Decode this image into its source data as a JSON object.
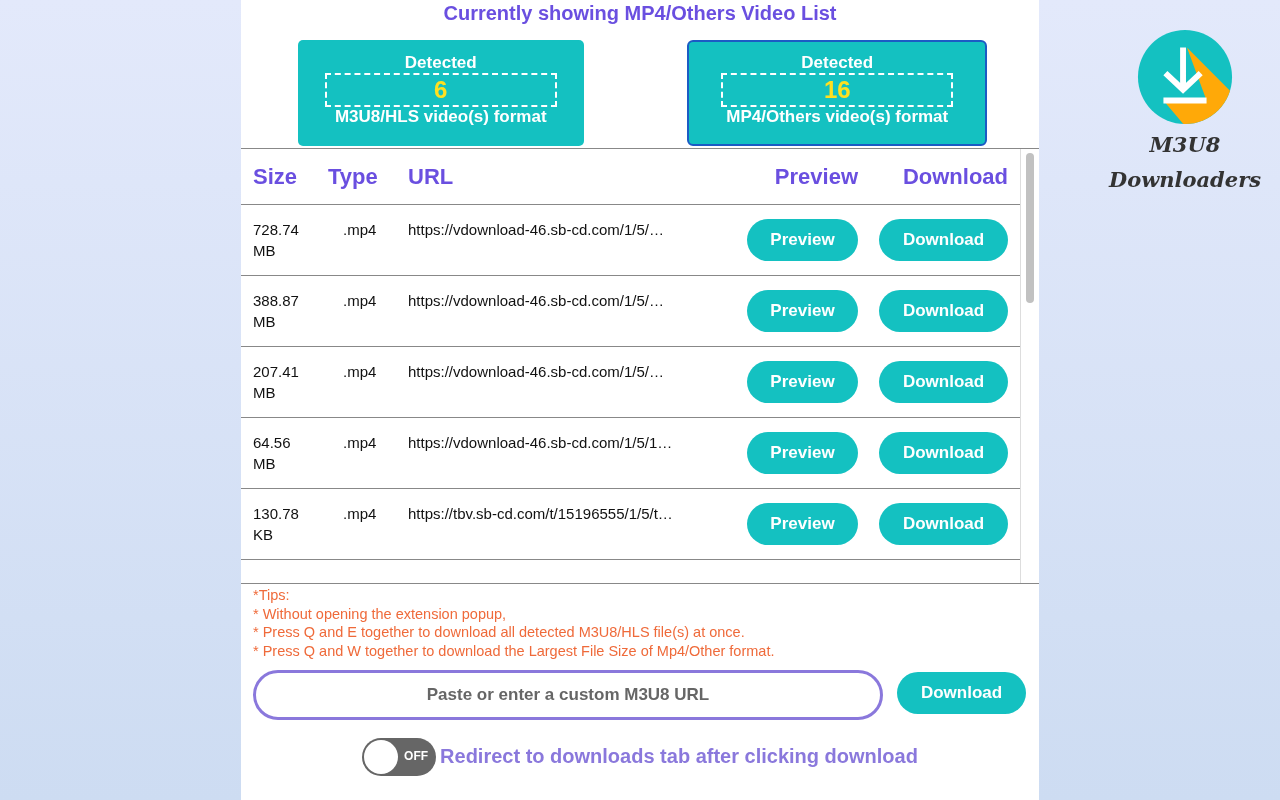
{
  "heading": "Currently showing MP4/Others Video List",
  "format_cards": [
    {
      "label": "Detected",
      "count": "6",
      "format": "M3U8/HLS video(s) format",
      "selected": false
    },
    {
      "label": "Detected",
      "count": "16",
      "format": "MP4/Others video(s) format",
      "selected": true
    }
  ],
  "table": {
    "columns": [
      "Size",
      "Type",
      "URL",
      "Preview",
      "Download"
    ],
    "rows": [
      {
        "size": "728.74 MB",
        "type": ".mp4",
        "url": "https://vdownload-46.sb-cd.com/1/5/…",
        "preview": "Preview",
        "download": "Download"
      },
      {
        "size": "388.87 MB",
        "type": ".mp4",
        "url": "https://vdownload-46.sb-cd.com/1/5/…",
        "preview": "Preview",
        "download": "Download"
      },
      {
        "size": "207.41 MB",
        "type": ".mp4",
        "url": "https://vdownload-46.sb-cd.com/1/5/…",
        "preview": "Preview",
        "download": "Download"
      },
      {
        "size": "64.56 MB",
        "type": ".mp4",
        "url": "https://vdownload-46.sb-cd.com/1/5/1…",
        "preview": "Preview",
        "download": "Download"
      },
      {
        "size": "130.78 KB",
        "type": ".mp4",
        "url": "https://tbv.sb-cd.com/t/15196555/1/5/t…",
        "preview": "Preview",
        "download": "Download"
      }
    ]
  },
  "tips": [
    "*Tips:",
    "* Without opening the extension popup,",
    "* Press Q and E together to download all detected M3U8/HLS file(s) at once.",
    "* Press Q and W together to download the Largest File Size of Mp4/Other format."
  ],
  "custom_url": {
    "placeholder": "Paste or enter a custom M3U8 URL",
    "button": "Download"
  },
  "redirect_toggle": {
    "on": false,
    "state_label": "OFF",
    "label": "Redirect to downloads tab after clicking download"
  },
  "logo": {
    "line_1": "M3U8",
    "line_2": "Downloaders"
  }
}
